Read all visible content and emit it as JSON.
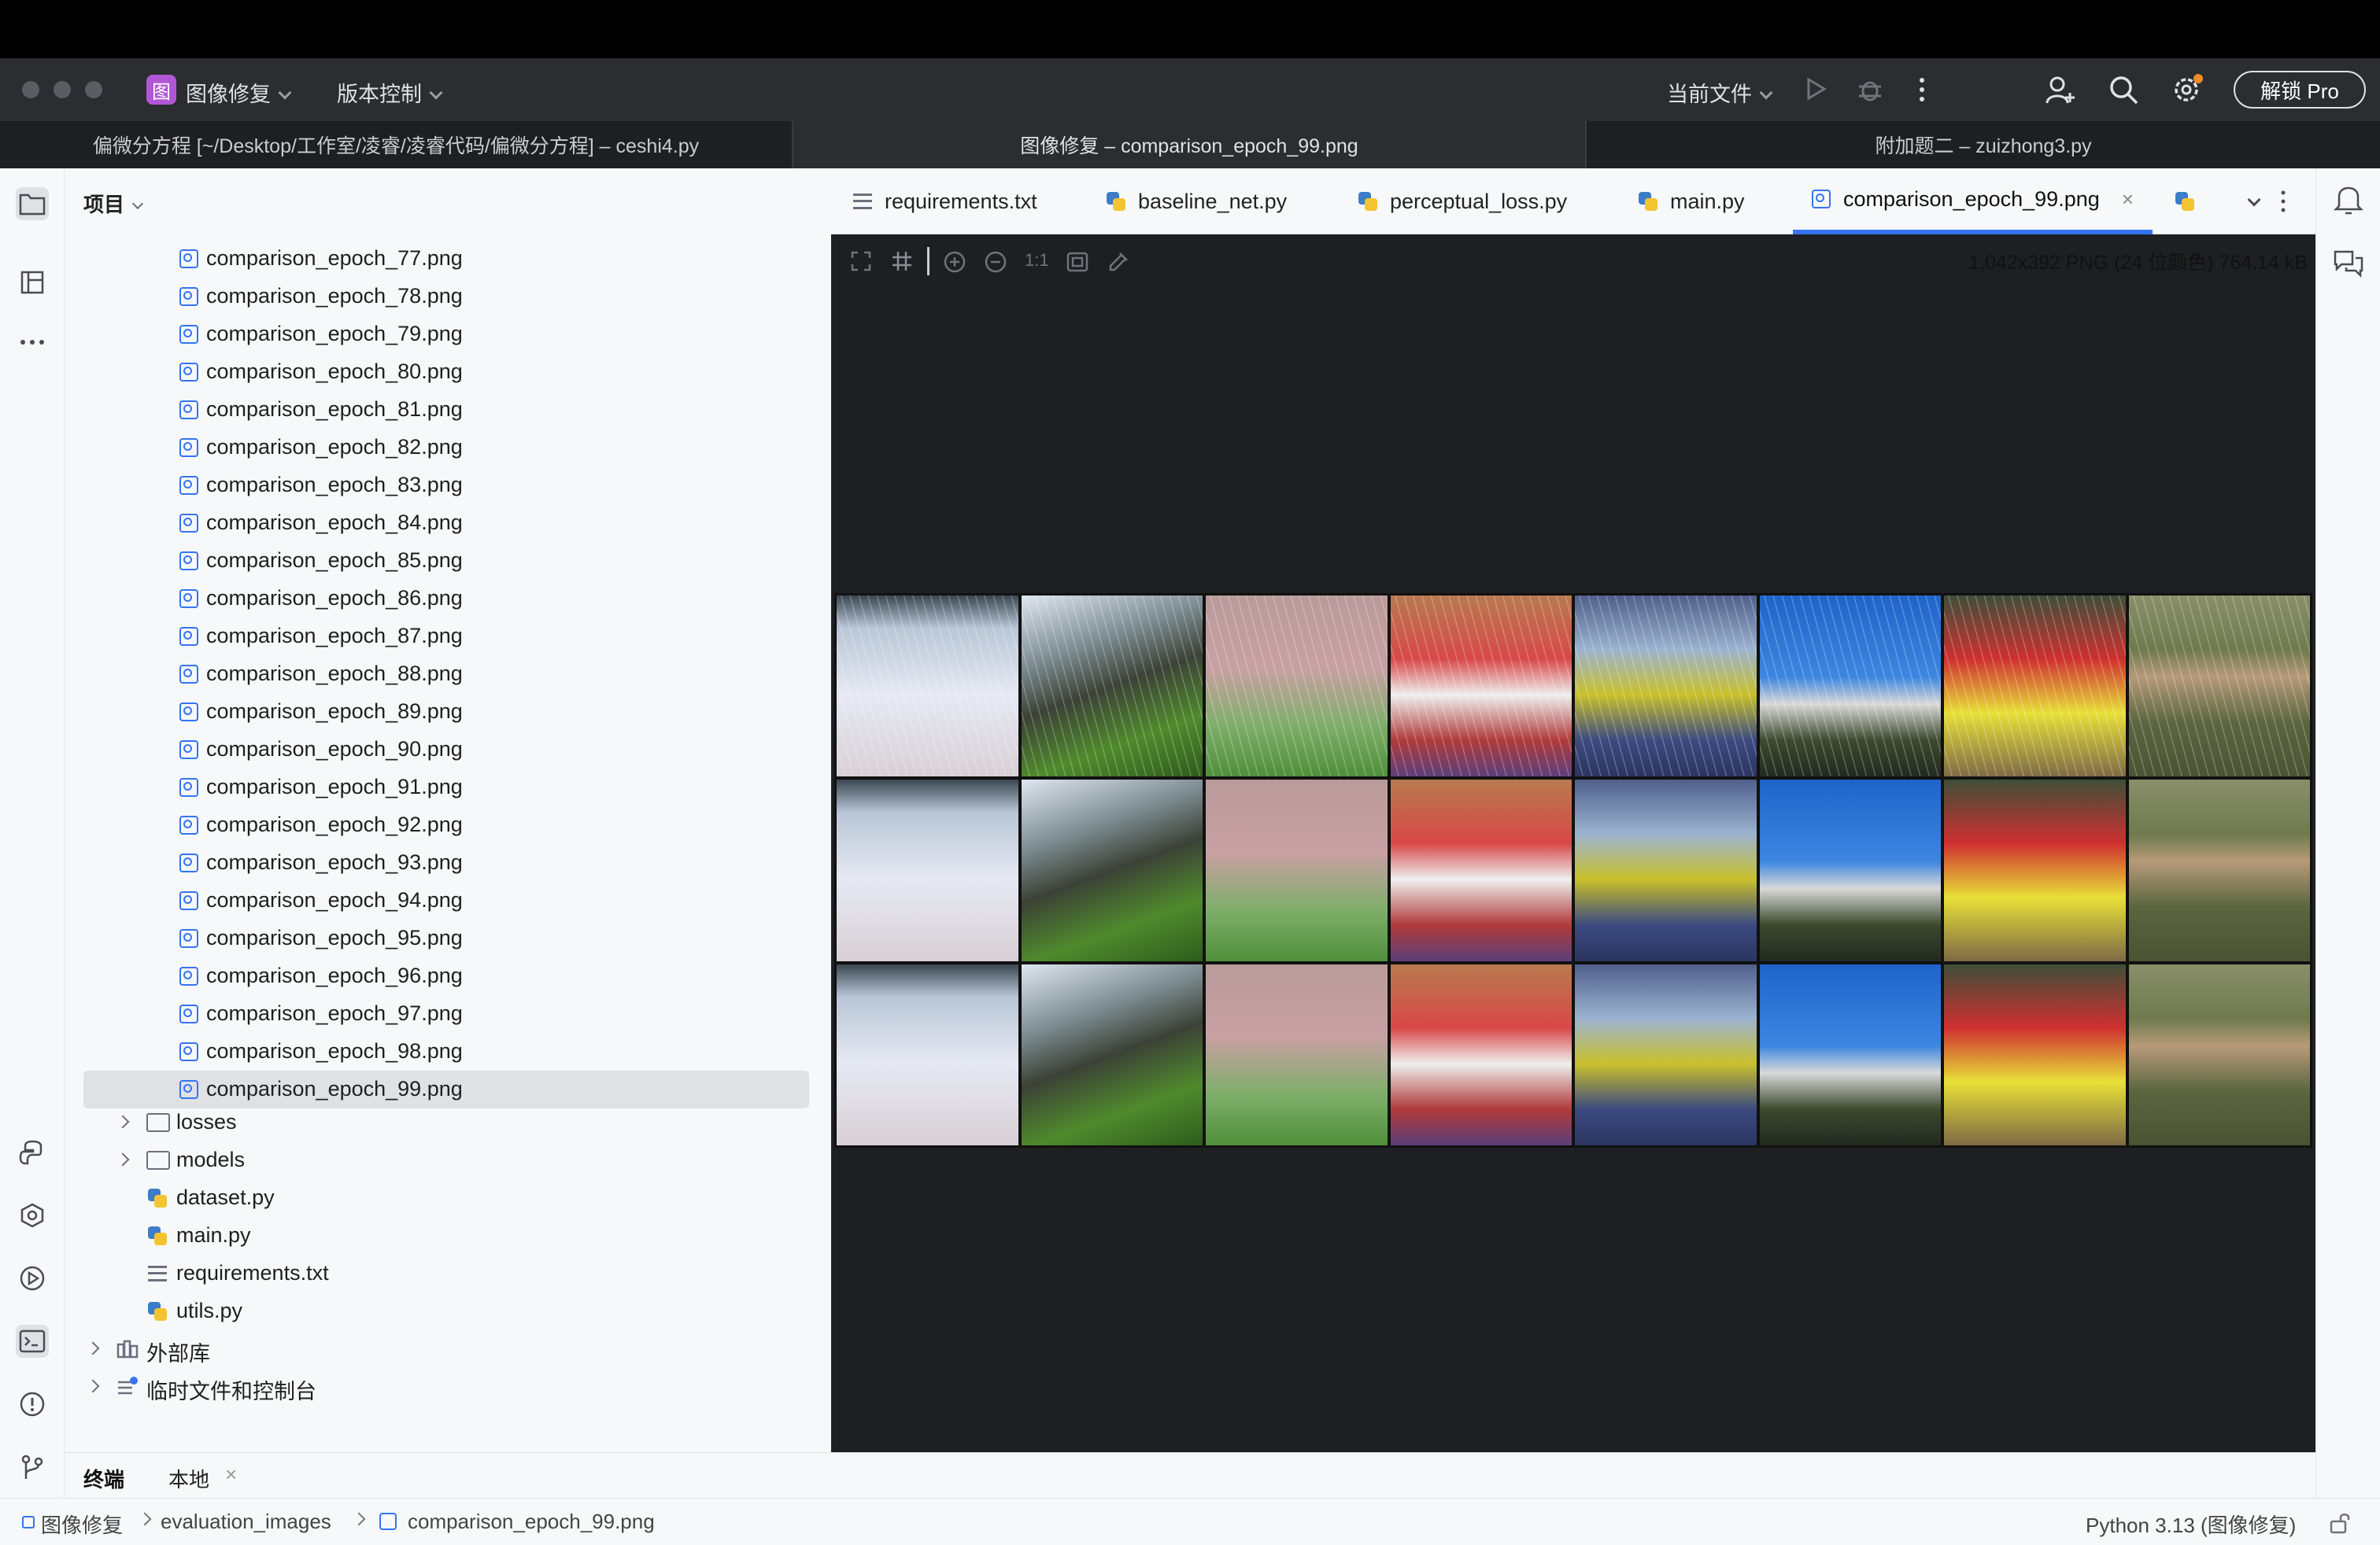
{
  "titlebar": {
    "project_name": "图像修复",
    "project_badge": "图",
    "vcs_menu": "版本控制",
    "run_config": "当前文件",
    "unlock_button": "解锁 Pro"
  },
  "window_tabs": [
    {
      "label": "偏微分方程 [~/Desktop/工作室/凌睿/凌睿代码/偏微分方程] – ceshi4.py"
    },
    {
      "label": "图像修复 – comparison_epoch_99.png"
    },
    {
      "label": "附加题二 – zuizhong3.py"
    }
  ],
  "project_panel": {
    "title": "项目",
    "files": [
      "comparison_epoch_77.png",
      "comparison_epoch_78.png",
      "comparison_epoch_79.png",
      "comparison_epoch_80.png",
      "comparison_epoch_81.png",
      "comparison_epoch_82.png",
      "comparison_epoch_83.png",
      "comparison_epoch_84.png",
      "comparison_epoch_85.png",
      "comparison_epoch_86.png",
      "comparison_epoch_87.png",
      "comparison_epoch_88.png",
      "comparison_epoch_89.png",
      "comparison_epoch_90.png",
      "comparison_epoch_91.png",
      "comparison_epoch_92.png",
      "comparison_epoch_93.png",
      "comparison_epoch_94.png",
      "comparison_epoch_95.png",
      "comparison_epoch_96.png",
      "comparison_epoch_97.png",
      "comparison_epoch_98.png",
      "comparison_epoch_99.png"
    ],
    "selected_file": "comparison_epoch_99.png",
    "folder_losses": "losses",
    "folder_models": "models",
    "file_dataset": "dataset.py",
    "file_main": "main.py",
    "file_requirements": "requirements.txt",
    "file_utils": "utils.py",
    "external_libs": "外部库",
    "scratches": "临时文件和控制台"
  },
  "editor_tabs": [
    {
      "label": "requirements.txt",
      "icon": "text-file-icon"
    },
    {
      "label": "baseline_net.py",
      "icon": "python-icon"
    },
    {
      "label": "perceptual_loss.py",
      "icon": "python-icon"
    },
    {
      "label": "main.py",
      "icon": "python-icon"
    },
    {
      "label": "comparison_epoch_99.png",
      "icon": "image-file-icon"
    }
  ],
  "image_viewer": {
    "zoom_label": "1:1",
    "info": "1,042x392 PNG (24 位颜色) 764.14 kB"
  },
  "bottom_tabs": {
    "terminal": "终端",
    "local": "本地"
  },
  "statusbar": {
    "crumb_project": "图像修复",
    "crumb_folder": "evaluation_images",
    "crumb_file": "comparison_epoch_99.png",
    "interpreter": "Python 3.13 (图像修复)"
  },
  "colors": {
    "accent": "#3574f0",
    "project_badge": "#b157d6",
    "titlebar_bg": "#2b2d30",
    "editor_bg": "#1e1f22"
  }
}
